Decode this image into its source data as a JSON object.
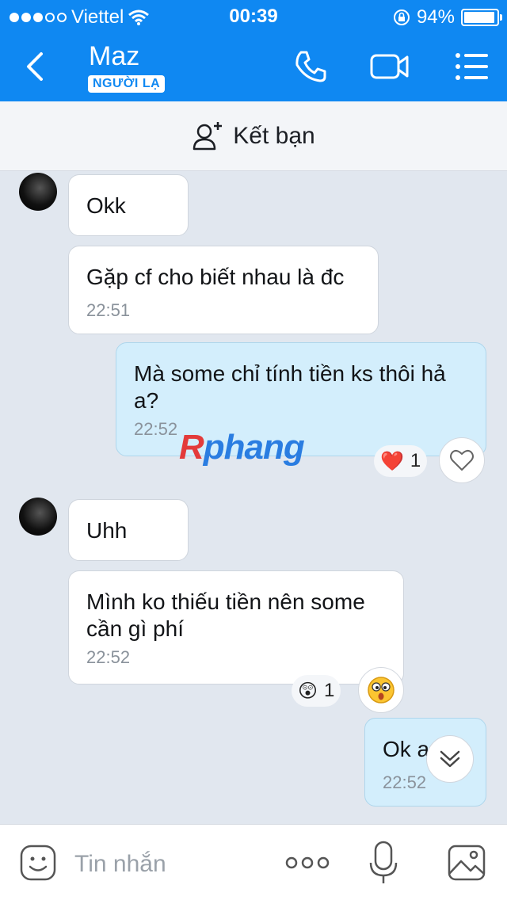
{
  "status_bar": {
    "carrier": "Viettel",
    "time": "00:39",
    "battery": "94%",
    "battery_level": 0.94,
    "signal_bars_filled": 3,
    "signal_bars_total": 5
  },
  "header": {
    "contact_name": "Maz",
    "badge": "NGƯỜI LẠ"
  },
  "add_friend": {
    "label": "Kết bạn"
  },
  "messages": [
    {
      "text": "Okk",
      "time": ""
    },
    {
      "text": "Gặp cf cho biết nhau là đc",
      "time": "22:51"
    },
    {
      "text": "Mà some chỉ tính tiền ks thôi hả a?",
      "time": "22:52",
      "reaction": "❤️",
      "reaction_count": "1"
    },
    {
      "text": "Uhh",
      "time": ""
    },
    {
      "text": "Mình ko thiếu tiền nên some cần gì phí",
      "time": "22:52",
      "reaction": "😲",
      "reaction_count": "1"
    },
    {
      "text": "Ok a",
      "time": "22:52"
    }
  ],
  "watermark": {
    "first": "R",
    "rest": "phang"
  },
  "input": {
    "placeholder": "Tin nhắn"
  },
  "colors": {
    "accent": "#0f88f2",
    "own_bubble": "#d3eefc",
    "background": "#e1e7ef"
  }
}
